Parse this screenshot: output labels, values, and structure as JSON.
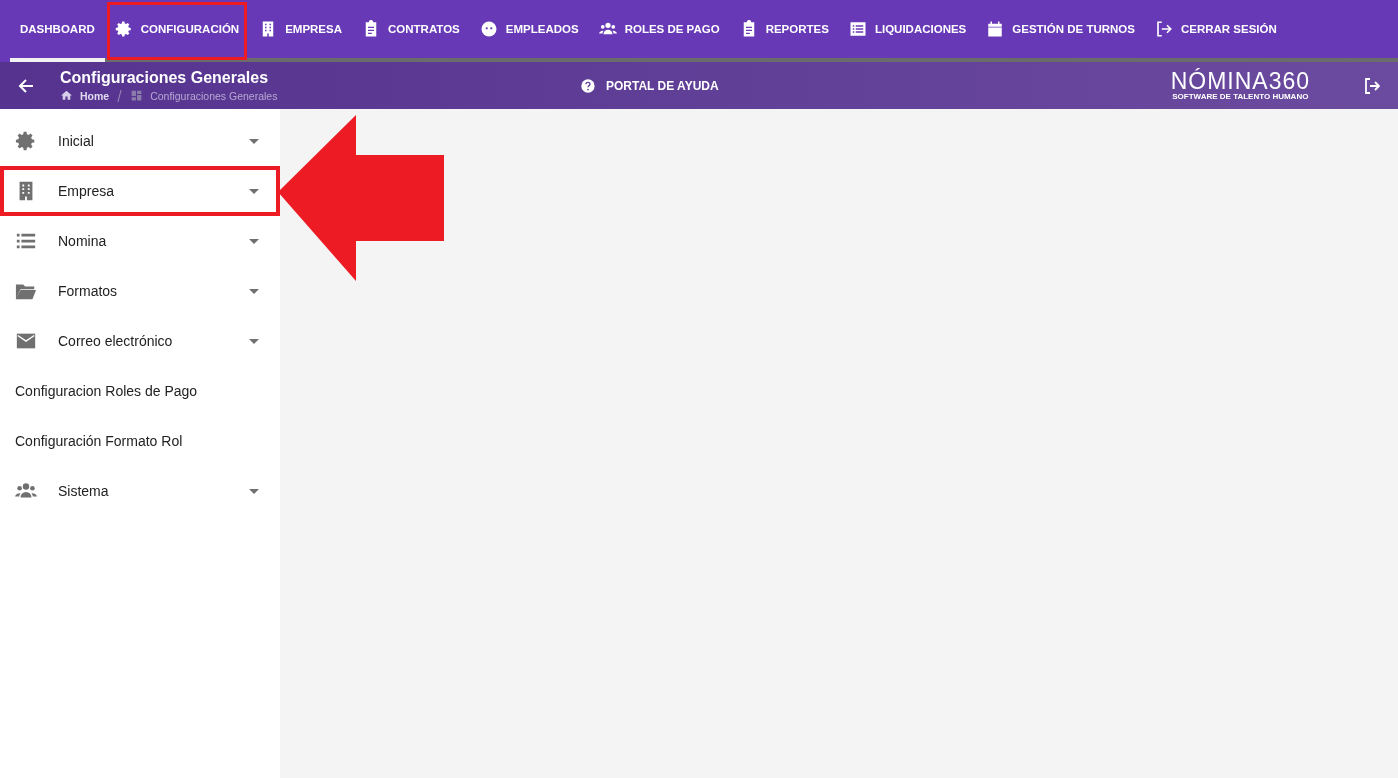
{
  "nav": [
    {
      "label": "DASHBOARD",
      "selected": true,
      "highlighted": false
    },
    {
      "label": "CONFIGURACIÓN",
      "selected": false,
      "highlighted": true
    },
    {
      "label": "EMPRESA",
      "selected": false,
      "highlighted": false
    },
    {
      "label": "CONTRATOS",
      "selected": false,
      "highlighted": false
    },
    {
      "label": "EMPLEADOS",
      "selected": false,
      "highlighted": false
    },
    {
      "label": "ROLES DE PAGO",
      "selected": false,
      "highlighted": false
    },
    {
      "label": "REPORTES",
      "selected": false,
      "highlighted": false
    },
    {
      "label": "LIQUIDACIONES",
      "selected": false,
      "highlighted": false
    },
    {
      "label": "GESTIÓN DE TURNOS",
      "selected": false,
      "highlighted": false
    },
    {
      "label": "CERRAR SESIÓN",
      "selected": false,
      "highlighted": false
    }
  ],
  "header": {
    "title": "Configuraciones Generales",
    "breadcrumb": [
      "Home",
      "Configuraciones Generales"
    ],
    "help": "PORTAL DE AYUDA",
    "logo": {
      "name": "NÓMINA360",
      "tagline": "SOFTWARE DE TALENTO HUMANO"
    }
  },
  "sidebar": {
    "items": [
      {
        "label": "Inicial",
        "expandable": true,
        "highlighted": false
      },
      {
        "label": "Empresa",
        "expandable": true,
        "highlighted": true
      },
      {
        "label": "Nomina",
        "expandable": true,
        "highlighted": false
      },
      {
        "label": "Formatos",
        "expandable": true,
        "highlighted": false
      },
      {
        "label": "Correo electrónico",
        "expandable": true,
        "highlighted": false
      },
      {
        "label": "Configuracion Roles de Pago",
        "expandable": false,
        "highlighted": false
      },
      {
        "label": "Configuración Formato Rol",
        "expandable": false,
        "highlighted": false
      },
      {
        "label": "Sistema",
        "expandable": true,
        "highlighted": false
      }
    ]
  },
  "annotation": {
    "kind": "arrow"
  }
}
